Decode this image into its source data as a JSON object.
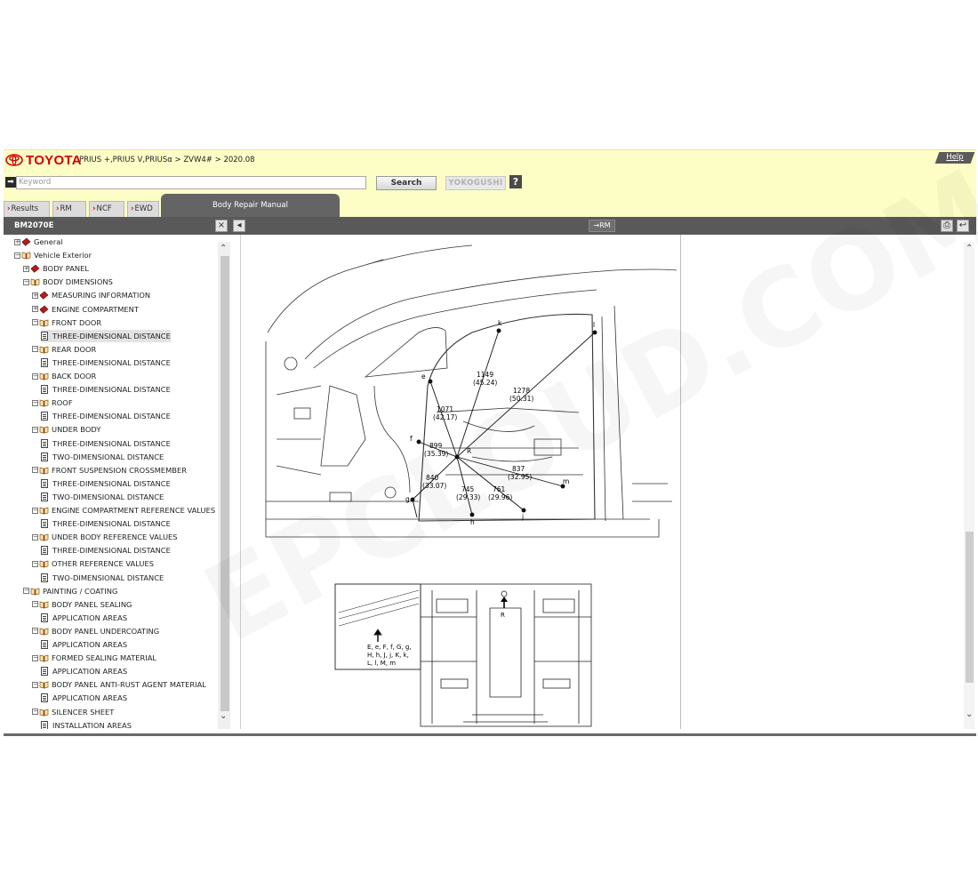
{
  "header": {
    "brand": "TOYOTA",
    "breadcrumb": "PRIUS +,PRIUS V,PRIUSα > ZVW4# > 2020.08",
    "help_label": "Help"
  },
  "search": {
    "placeholder": "Keyword",
    "search_label": "Search",
    "yokogushi_label": "YOKOGUSHI",
    "help_label": "?"
  },
  "tabs": [
    {
      "label": "Results"
    },
    {
      "label": "RM"
    },
    {
      "label": "NCF"
    },
    {
      "label": "EWD"
    }
  ],
  "active_tab": "Body Repair Manual",
  "toolbar": {
    "doc_id": "BM2070E",
    "close_label": "×",
    "collapse_label": "◂",
    "rm_label": "→RM"
  },
  "tree": [
    {
      "label": "General",
      "type": "book",
      "level": 1,
      "toggle": "+"
    },
    {
      "label": "Vehicle Exterior",
      "type": "open",
      "level": 1,
      "toggle": "-"
    },
    {
      "label": "BODY PANEL",
      "type": "book",
      "level": 2,
      "toggle": "+"
    },
    {
      "label": "BODY DIMENSIONS",
      "type": "open",
      "level": 2,
      "toggle": "-"
    },
    {
      "label": "MEASURING INFORMATION",
      "type": "book",
      "level": 3,
      "toggle": "+"
    },
    {
      "label": "ENGINE COMPARTMENT",
      "type": "book",
      "level": 3,
      "toggle": "+"
    },
    {
      "label": "FRONT DOOR",
      "type": "open",
      "level": 3,
      "toggle": "-"
    },
    {
      "label": "THREE-DIMENSIONAL DISTANCE",
      "type": "doc",
      "level": 4,
      "selected": true
    },
    {
      "label": "REAR DOOR",
      "type": "open",
      "level": 3,
      "toggle": "-"
    },
    {
      "label": "THREE-DIMENSIONAL DISTANCE",
      "type": "doc",
      "level": 4
    },
    {
      "label": "BACK DOOR",
      "type": "open",
      "level": 3,
      "toggle": "-"
    },
    {
      "label": "THREE-DIMENSIONAL DISTANCE",
      "type": "doc",
      "level": 4
    },
    {
      "label": "ROOF",
      "type": "open",
      "level": 3,
      "toggle": "-"
    },
    {
      "label": "THREE-DIMENSIONAL DISTANCE",
      "type": "doc",
      "level": 4
    },
    {
      "label": "UNDER BODY",
      "type": "open",
      "level": 3,
      "toggle": "-"
    },
    {
      "label": "THREE-DIMENSIONAL DISTANCE",
      "type": "doc",
      "level": 4
    },
    {
      "label": "TWO-DIMENSIONAL DISTANCE",
      "type": "doc",
      "level": 4
    },
    {
      "label": "FRONT SUSPENSION CROSSMEMBER",
      "type": "open",
      "level": 3,
      "toggle": "-"
    },
    {
      "label": "THREE-DIMENSIONAL DISTANCE",
      "type": "doc",
      "level": 4
    },
    {
      "label": "TWO-DIMENSIONAL DISTANCE",
      "type": "doc",
      "level": 4
    },
    {
      "label": "ENGINE COMPARTMENT REFERENCE VALUES",
      "type": "open",
      "level": 3,
      "toggle": "-"
    },
    {
      "label": "THREE-DIMENSIONAL DISTANCE",
      "type": "doc",
      "level": 4
    },
    {
      "label": "UNDER BODY REFERENCE VALUES",
      "type": "open",
      "level": 3,
      "toggle": "-"
    },
    {
      "label": "THREE-DIMENSIONAL DISTANCE",
      "type": "doc",
      "level": 4
    },
    {
      "label": "OTHER REFERENCE VALUES",
      "type": "open",
      "level": 3,
      "toggle": "-"
    },
    {
      "label": "TWO-DIMENSIONAL DISTANCE",
      "type": "doc",
      "level": 4
    },
    {
      "label": "PAINTING / COATING",
      "type": "open",
      "level": 2,
      "toggle": "-"
    },
    {
      "label": "BODY PANEL SEALING",
      "type": "open",
      "level": 3,
      "toggle": "-"
    },
    {
      "label": "APPLICATION AREAS",
      "type": "doc",
      "level": 4
    },
    {
      "label": "BODY PANEL UNDERCOATING",
      "type": "open",
      "level": 3,
      "toggle": "-"
    },
    {
      "label": "APPLICATION AREAS",
      "type": "doc",
      "level": 4
    },
    {
      "label": "FORMED SEALING MATERIAL",
      "type": "open",
      "level": 3,
      "toggle": "-"
    },
    {
      "label": "APPLICATION AREAS",
      "type": "doc",
      "level": 4
    },
    {
      "label": "BODY PANEL ANTI-RUST AGENT MATERIAL",
      "type": "open",
      "level": 3,
      "toggle": "-"
    },
    {
      "label": "APPLICATION AREAS",
      "type": "doc",
      "level": 4
    },
    {
      "label": "SILENCER SHEET",
      "type": "open",
      "level": 3,
      "toggle": "-"
    },
    {
      "label": "INSTALLATION AREAS",
      "type": "doc",
      "level": 4
    }
  ],
  "diagram": {
    "points": [
      "k",
      "l",
      "e",
      "f",
      "g",
      "h",
      "j",
      "m",
      "R"
    ],
    "dimensions": [
      {
        "value": "1149",
        "inch": "(45.24)"
      },
      {
        "value": "1278",
        "inch": "(50.31)"
      },
      {
        "value": "1071",
        "inch": "(42.17)"
      },
      {
        "value": "899",
        "inch": "(35.39)"
      },
      {
        "value": "837",
        "inch": "(32.95)"
      },
      {
        "value": "840",
        "inch": "(33.07)"
      },
      {
        "value": "745",
        "inch": "(29.33)"
      },
      {
        "value": "761",
        "inch": "(29.96)"
      }
    ],
    "inset_lines": [
      "E, e, F, f, G, g,",
      "H, h, J, j, K, k,",
      "L, l, M, m"
    ],
    "inset_point": "R"
  },
  "watermark": "EPCLOUD.COM",
  "colors": {
    "brand_red": "#d40000",
    "header_bg": "#fdfdc6",
    "bar_bg": "#595959"
  }
}
